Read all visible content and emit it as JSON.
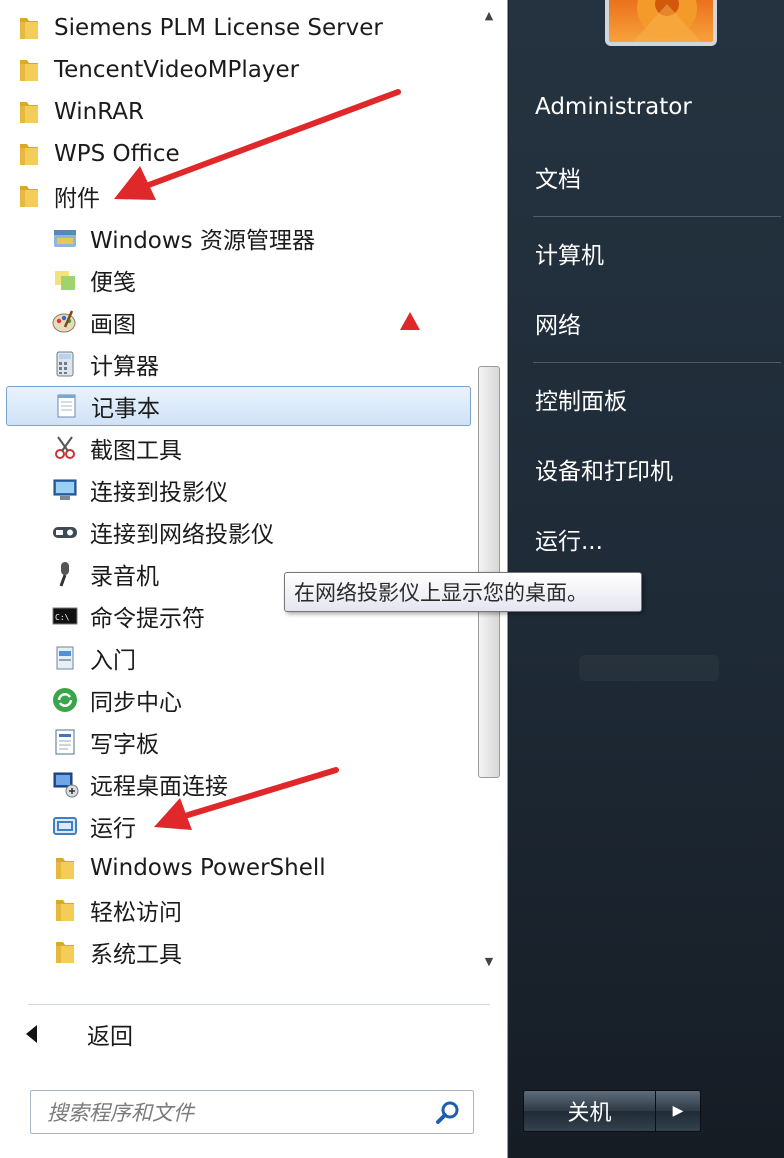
{
  "programs": {
    "items": [
      {
        "label": "Siemens PLM License Server",
        "icon": "folder-icon",
        "level": "top"
      },
      {
        "label": "TencentVideoMPlayer",
        "icon": "folder-icon",
        "level": "top"
      },
      {
        "label": "WinRAR",
        "icon": "folder-icon",
        "level": "top"
      },
      {
        "label": "WPS Office",
        "icon": "folder-icon",
        "level": "top"
      },
      {
        "label": "附件",
        "icon": "folder-icon",
        "level": "top"
      },
      {
        "label": "Windows 资源管理器",
        "icon": "explorer-icon",
        "level": "sub"
      },
      {
        "label": "便笺",
        "icon": "sticky-notes-icon",
        "level": "sub"
      },
      {
        "label": "画图",
        "icon": "paint-icon",
        "level": "sub"
      },
      {
        "label": "计算器",
        "icon": "calculator-icon",
        "level": "sub"
      },
      {
        "label": "记事本",
        "icon": "notepad-icon",
        "level": "sub",
        "selected": true
      },
      {
        "label": "截图工具",
        "icon": "snipping-tool-icon",
        "level": "sub"
      },
      {
        "label": "连接到投影仪",
        "icon": "projector-icon",
        "level": "sub"
      },
      {
        "label": "连接到网络投影仪",
        "icon": "network-projector-icon",
        "level": "sub"
      },
      {
        "label": "录音机",
        "icon": "microphone-icon",
        "level": "sub"
      },
      {
        "label": "命令提示符",
        "icon": "command-prompt-icon",
        "level": "sub"
      },
      {
        "label": "入门",
        "icon": "getting-started-icon",
        "level": "sub"
      },
      {
        "label": "同步中心",
        "icon": "sync-center-icon",
        "level": "sub"
      },
      {
        "label": "写字板",
        "icon": "wordpad-icon",
        "level": "sub"
      },
      {
        "label": "远程桌面连接",
        "icon": "remote-desktop-icon",
        "level": "sub"
      },
      {
        "label": "运行",
        "icon": "run-icon",
        "level": "sub"
      },
      {
        "label": "Windows PowerShell",
        "icon": "folder-icon",
        "level": "sub"
      },
      {
        "label": "轻松访问",
        "icon": "folder-icon",
        "level": "sub"
      },
      {
        "label": "系统工具",
        "icon": "folder-icon",
        "level": "sub"
      }
    ]
  },
  "back_label": "返回",
  "search": {
    "placeholder": "搜索程序和文件"
  },
  "tooltip": "在网络投影仪上显示您的桌面。",
  "right_panel": {
    "items": [
      "Administrator",
      "文档",
      "计算机",
      "网络",
      "控制面板",
      "设备和打印机",
      "运行..."
    ]
  },
  "shutdown": {
    "label": "关机"
  },
  "colors": {
    "annotation_red": "#e0282a",
    "selection_border": "#7da2ce",
    "right_panel_bg": "#1e2a36"
  }
}
